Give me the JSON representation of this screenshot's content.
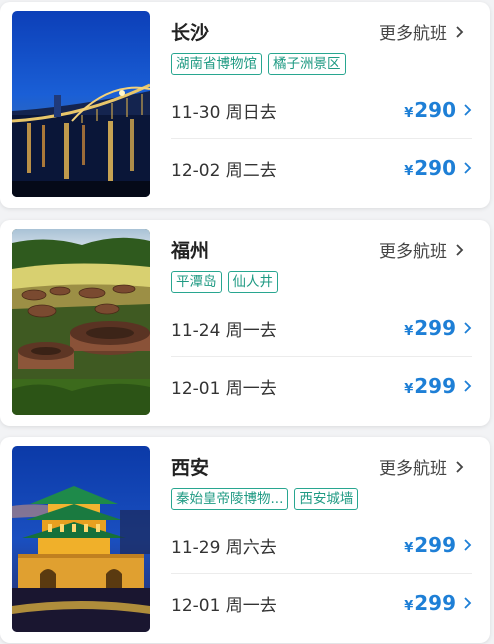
{
  "cards": [
    {
      "city": "长沙",
      "more_label": "更多航班",
      "tags": [
        "湖南省博物馆",
        "橘子洲景区"
      ],
      "flights": [
        {
          "date": "11-30 周日去",
          "currency": "¥",
          "price": "290"
        },
        {
          "date": "12-02 周二去",
          "currency": "¥",
          "price": "290"
        }
      ]
    },
    {
      "city": "福州",
      "more_label": "更多航班",
      "tags": [
        "平潭岛",
        "仙人井"
      ],
      "flights": [
        {
          "date": "11-24 周一去",
          "currency": "¥",
          "price": "299"
        },
        {
          "date": "12-01 周一去",
          "currency": "¥",
          "price": "299"
        }
      ]
    },
    {
      "city": "西安",
      "more_label": "更多航班",
      "tags": [
        "秦始皇帝陵博物...",
        "西安城墙"
      ],
      "flights": [
        {
          "date": "11-29 周六去",
          "currency": "¥",
          "price": "299"
        },
        {
          "date": "12-01 周一去",
          "currency": "¥",
          "price": "299"
        }
      ]
    }
  ],
  "colors": {
    "price": "#1e7fd6",
    "tag": "#1f9a83",
    "background": "#f2f3f5"
  },
  "icons": {
    "more": "chevron-right-icon",
    "price": "chevron-right-icon"
  }
}
